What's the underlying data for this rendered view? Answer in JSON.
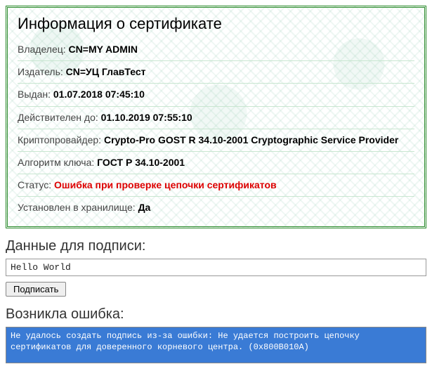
{
  "cert": {
    "title": "Информация о сертификате",
    "owner_label": "Владелец: ",
    "owner_value": "CN=MY ADMIN",
    "issuer_label": "Издатель: ",
    "issuer_value": "CN=УЦ ГлавТест",
    "issued_label": "Выдан: ",
    "issued_value": "01.07.2018 07:45:10",
    "valid_to_label": "Действителен до: ",
    "valid_to_value": "01.10.2019 07:55:10",
    "provider_label": "Криптопровайдер: ",
    "provider_value": "Crypto-Pro GOST R 34.10-2001 Cryptographic Service Provider",
    "algo_label": "Алгоритм ключа: ",
    "algo_value": "ГОСТ Р 34.10-2001",
    "status_label": "Статус: ",
    "status_value": "Ошибка при проверке цепочки сертификатов",
    "installed_label": "Установлен в хранилище: ",
    "installed_value": "Да"
  },
  "sign": {
    "heading": "Данные для подписи:",
    "input_value": "Hello World",
    "button_label": "Подписать"
  },
  "error": {
    "heading": "Возникла ошибка:",
    "message": "Не удалось создать подпись из-за ошибки: Не удается построить цепочку сертификатов для доверенного корневого центра. (0x800B010A)"
  }
}
